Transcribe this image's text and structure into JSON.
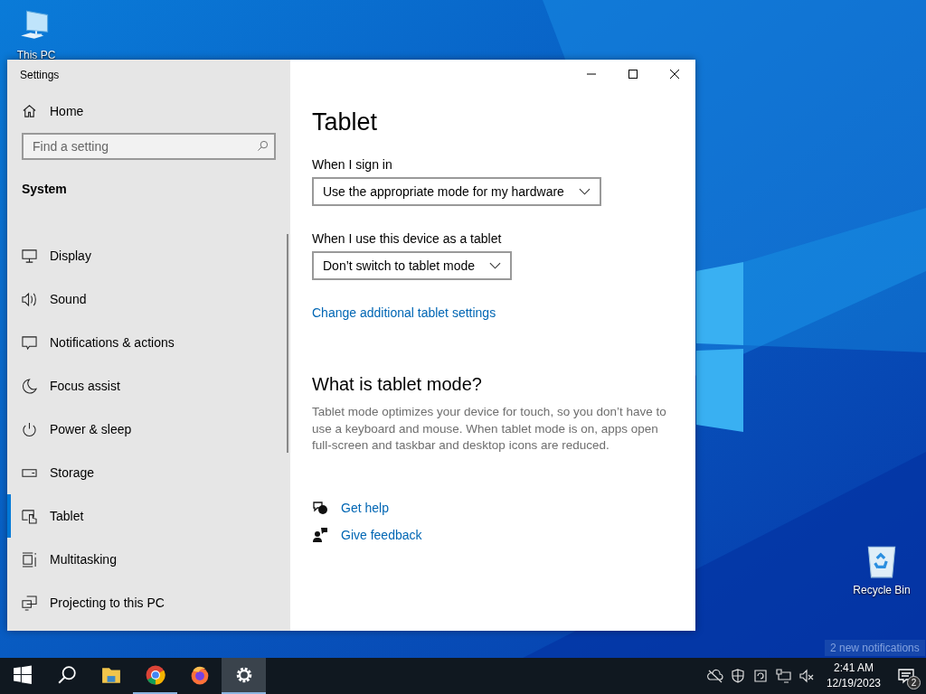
{
  "desktop": {
    "icons": [
      {
        "label": "This PC",
        "kind": "computer"
      },
      {
        "label": "Recycle Bin",
        "kind": "recycle"
      }
    ]
  },
  "window": {
    "title": "Settings"
  },
  "sidebar": {
    "home": "Home",
    "search": {
      "placeholder": "Find a setting"
    },
    "section": "System",
    "items": [
      {
        "label": "Display",
        "selected": false
      },
      {
        "label": "Sound",
        "selected": false
      },
      {
        "label": "Notifications & actions",
        "selected": false
      },
      {
        "label": "Focus assist",
        "selected": false
      },
      {
        "label": "Power & sleep",
        "selected": false
      },
      {
        "label": "Storage",
        "selected": false
      },
      {
        "label": "Tablet",
        "selected": true
      },
      {
        "label": "Multitasking",
        "selected": false
      },
      {
        "label": "Projecting to this PC",
        "selected": false
      }
    ]
  },
  "content": {
    "title": "Tablet",
    "settings": [
      {
        "label": "When I sign in",
        "value": "Use the appropriate mode for my hardware"
      },
      {
        "label": "When I use this device as a tablet",
        "value": "Don’t switch to tablet mode"
      }
    ],
    "link": "Change additional tablet settings",
    "heading": "What is tablet mode?",
    "description": "Tablet mode optimizes your device for touch, so you don’t have to use a keyboard and mouse. When tablet mode is on, apps open full-screen and taskbar and desktop icons are reduced.",
    "help_links": [
      "Get help",
      "Give feedback"
    ]
  },
  "taskbar": {
    "apps": [
      {
        "kind": "start",
        "running": false,
        "selected": false
      },
      {
        "kind": "search",
        "running": false,
        "selected": false
      },
      {
        "kind": "explorer",
        "running": false,
        "selected": false
      },
      {
        "kind": "chrome",
        "running": true,
        "selected": false
      },
      {
        "kind": "firefox",
        "running": false,
        "selected": false
      },
      {
        "kind": "settings",
        "running": true,
        "selected": true
      }
    ],
    "time": "2:41 AM",
    "date": "12/19/2023",
    "notification_count": "2",
    "tooltip": "2 new notifications"
  }
}
